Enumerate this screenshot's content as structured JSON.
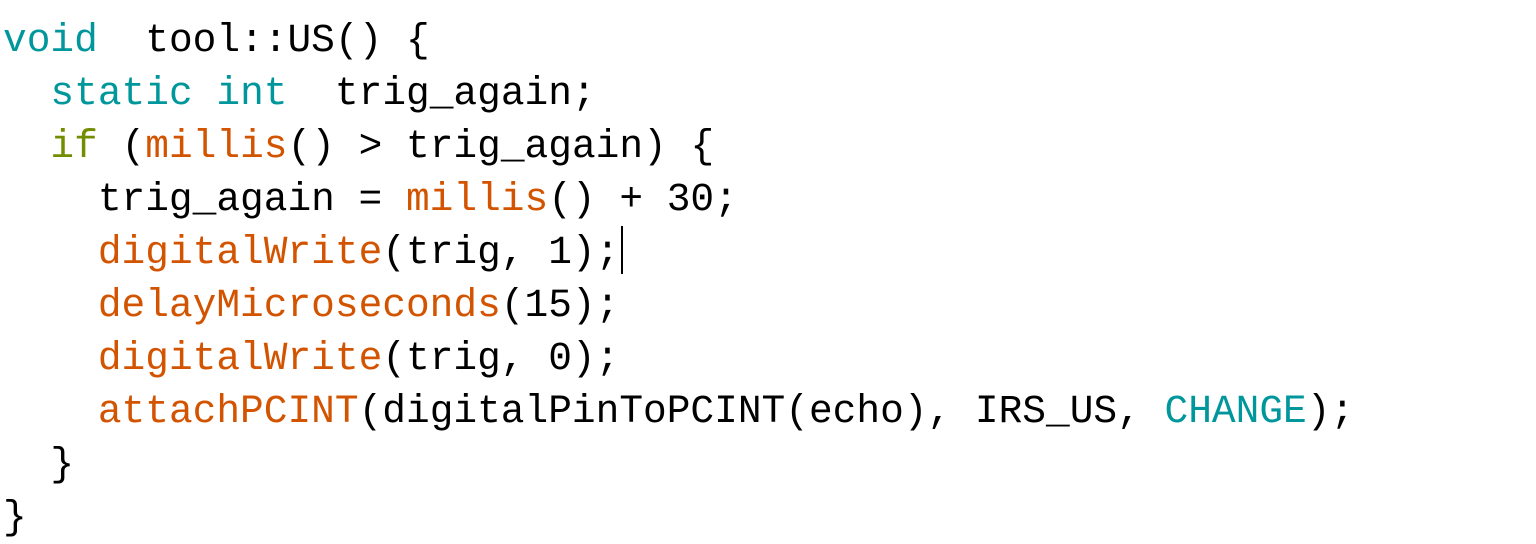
{
  "editor": {
    "lines": [
      [
        {
          "t": "void",
          "c": "keyword"
        },
        {
          "t": "  tool::US() {",
          "c": "plain"
        }
      ],
      [
        {
          "t": "  ",
          "c": "plain"
        },
        {
          "t": "static",
          "c": "keyword"
        },
        {
          "t": " ",
          "c": "plain"
        },
        {
          "t": "int",
          "c": "keyword"
        },
        {
          "t": "  trig_again;",
          "c": "plain"
        }
      ],
      [
        {
          "t": "  ",
          "c": "plain"
        },
        {
          "t": "if",
          "c": "control"
        },
        {
          "t": " (",
          "c": "plain"
        },
        {
          "t": "millis",
          "c": "function"
        },
        {
          "t": "() > trig_again) {",
          "c": "plain"
        }
      ],
      [
        {
          "t": "    trig_again = ",
          "c": "plain"
        },
        {
          "t": "millis",
          "c": "function"
        },
        {
          "t": "() + 30;",
          "c": "plain"
        }
      ],
      [
        {
          "t": "    ",
          "c": "plain"
        },
        {
          "t": "digitalWrite",
          "c": "function"
        },
        {
          "t": "(trig, 1);",
          "c": "plain",
          "caret": true
        }
      ],
      [
        {
          "t": "    ",
          "c": "plain"
        },
        {
          "t": "delayMicroseconds",
          "c": "function"
        },
        {
          "t": "(15);",
          "c": "plain"
        }
      ],
      [
        {
          "t": "    ",
          "c": "plain"
        },
        {
          "t": "digitalWrite",
          "c": "function"
        },
        {
          "t": "(trig, 0);",
          "c": "plain"
        }
      ],
      [
        {
          "t": "    ",
          "c": "plain"
        },
        {
          "t": "attachPCINT",
          "c": "function"
        },
        {
          "t": "(digitalPinToPCINT(echo), IRS_US, ",
          "c": "plain"
        },
        {
          "t": "CHANGE",
          "c": "constant"
        },
        {
          "t": ");",
          "c": "plain"
        }
      ],
      [
        {
          "t": "  }",
          "c": "plain"
        }
      ],
      [
        {
          "t": "}",
          "c": "plain"
        }
      ]
    ]
  }
}
